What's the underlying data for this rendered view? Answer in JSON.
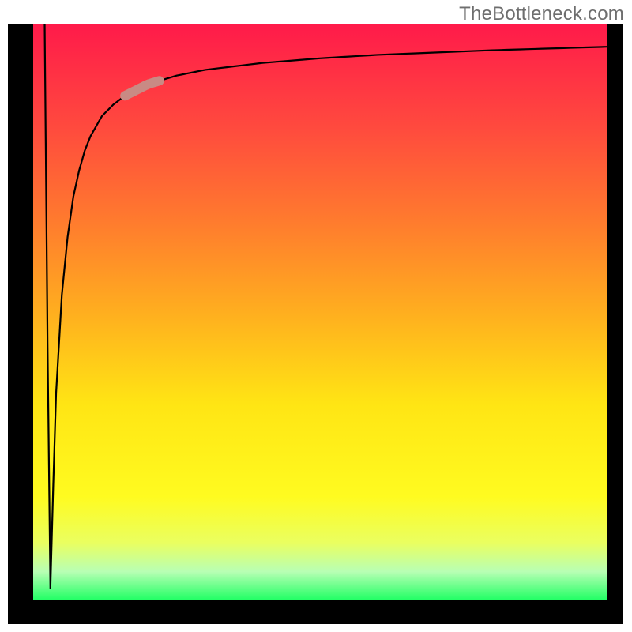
{
  "watermark_text": "TheBottleneck.com",
  "colors": {
    "curve_stroke": "#000000",
    "highlight_segment": "#c98a84",
    "gradient_top": "#ff1a4a",
    "gradient_bottom": "#20ff64",
    "border": "#000000",
    "watermark": "#6e6e6e"
  },
  "chart_data": {
    "type": "line",
    "title": "",
    "xlabel": "",
    "ylabel": "",
    "xlim": [
      0,
      100
    ],
    "ylim": [
      0,
      100
    ],
    "grid": false,
    "legend": false,
    "series": [
      {
        "name": "main-curve",
        "x": [
          2,
          2.5,
          3,
          3.5,
          4,
          5,
          6,
          7,
          8,
          9,
          10,
          12,
          14,
          16,
          18,
          20,
          25,
          30,
          40,
          50,
          60,
          70,
          80,
          90,
          100
        ],
        "y": [
          100,
          45,
          2,
          20,
          36,
          53,
          63,
          70,
          74.5,
          78,
          80.5,
          84,
          86,
          87.5,
          88.5,
          89.5,
          91,
          92,
          93.2,
          94,
          94.6,
          95,
          95.4,
          95.7,
          96
        ]
      }
    ],
    "highlight_segment": {
      "series": "main-curve",
      "x_start": 16,
      "x_end": 22,
      "note": "peach/rose thickened region on the rising part of the curve"
    },
    "description": "A single black curve on a vertical red→yellow→green gradient. The curve starts at the top-left, plunges sharply to the bottom (near x≈3), then rebounds steeply and asymptotically approaches ~96% toward the right edge. A short peach-colored thick segment overlays the curve roughly between x≈16 and x≈22."
  }
}
